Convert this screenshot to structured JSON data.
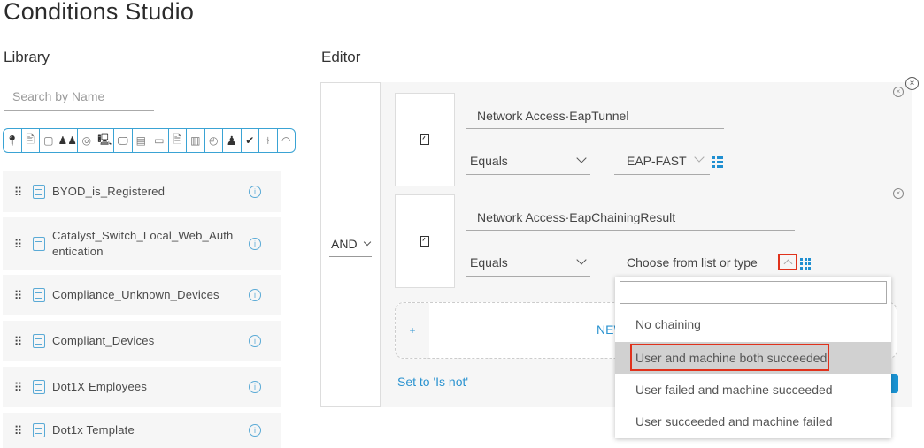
{
  "page_title": "Conditions Studio",
  "library": {
    "heading": "Library",
    "search_placeholder": "Search by Name",
    "filter_icons": [
      "location-icon",
      "id-card-icon",
      "square-icon",
      "users-group-icon",
      "globe-icon",
      "network-device-icon",
      "monitor-icon",
      "device-stack-icon",
      "router-icon",
      "document-icon",
      "server-icon",
      "clock-icon",
      "user-icon",
      "check-circle-icon",
      "flow-icon",
      "wifi-icon"
    ],
    "items": [
      {
        "name": "BYOD_is_Registered"
      },
      {
        "name": "Catalyst_Switch_Local_Web_Authentication"
      },
      {
        "name": "Compliance_Unknown_Devices"
      },
      {
        "name": "Compliant_Devices"
      },
      {
        "name": "Dot1X Employees"
      },
      {
        "name": "Dot1x Template"
      }
    ]
  },
  "editor": {
    "heading": "Editor",
    "logic_operator": "AND",
    "conditions": [
      {
        "attribute": "Network Access·EapTunnel",
        "operator": "Equals",
        "value": "EAP-FAST"
      },
      {
        "attribute": "Network Access·EapChainingResult",
        "operator": "Equals",
        "value_placeholder": "Choose from list or type"
      }
    ],
    "new_label": "NEW",
    "plus_label": "+",
    "set_is_not_label": "Set to 'Is not'",
    "dropdown": {
      "search_value": "",
      "options": [
        {
          "label": "No chaining",
          "selected": false
        },
        {
          "label": "User and machine both succeeded",
          "selected": true
        },
        {
          "label": "User failed and machine succeeded",
          "selected": false
        },
        {
          "label": "User succeeded and machine failed",
          "selected": false
        }
      ]
    }
  },
  "colors": {
    "accent": "#1f8fd1",
    "highlight": "#e0321c",
    "selected_option": "#d1d1d1"
  }
}
